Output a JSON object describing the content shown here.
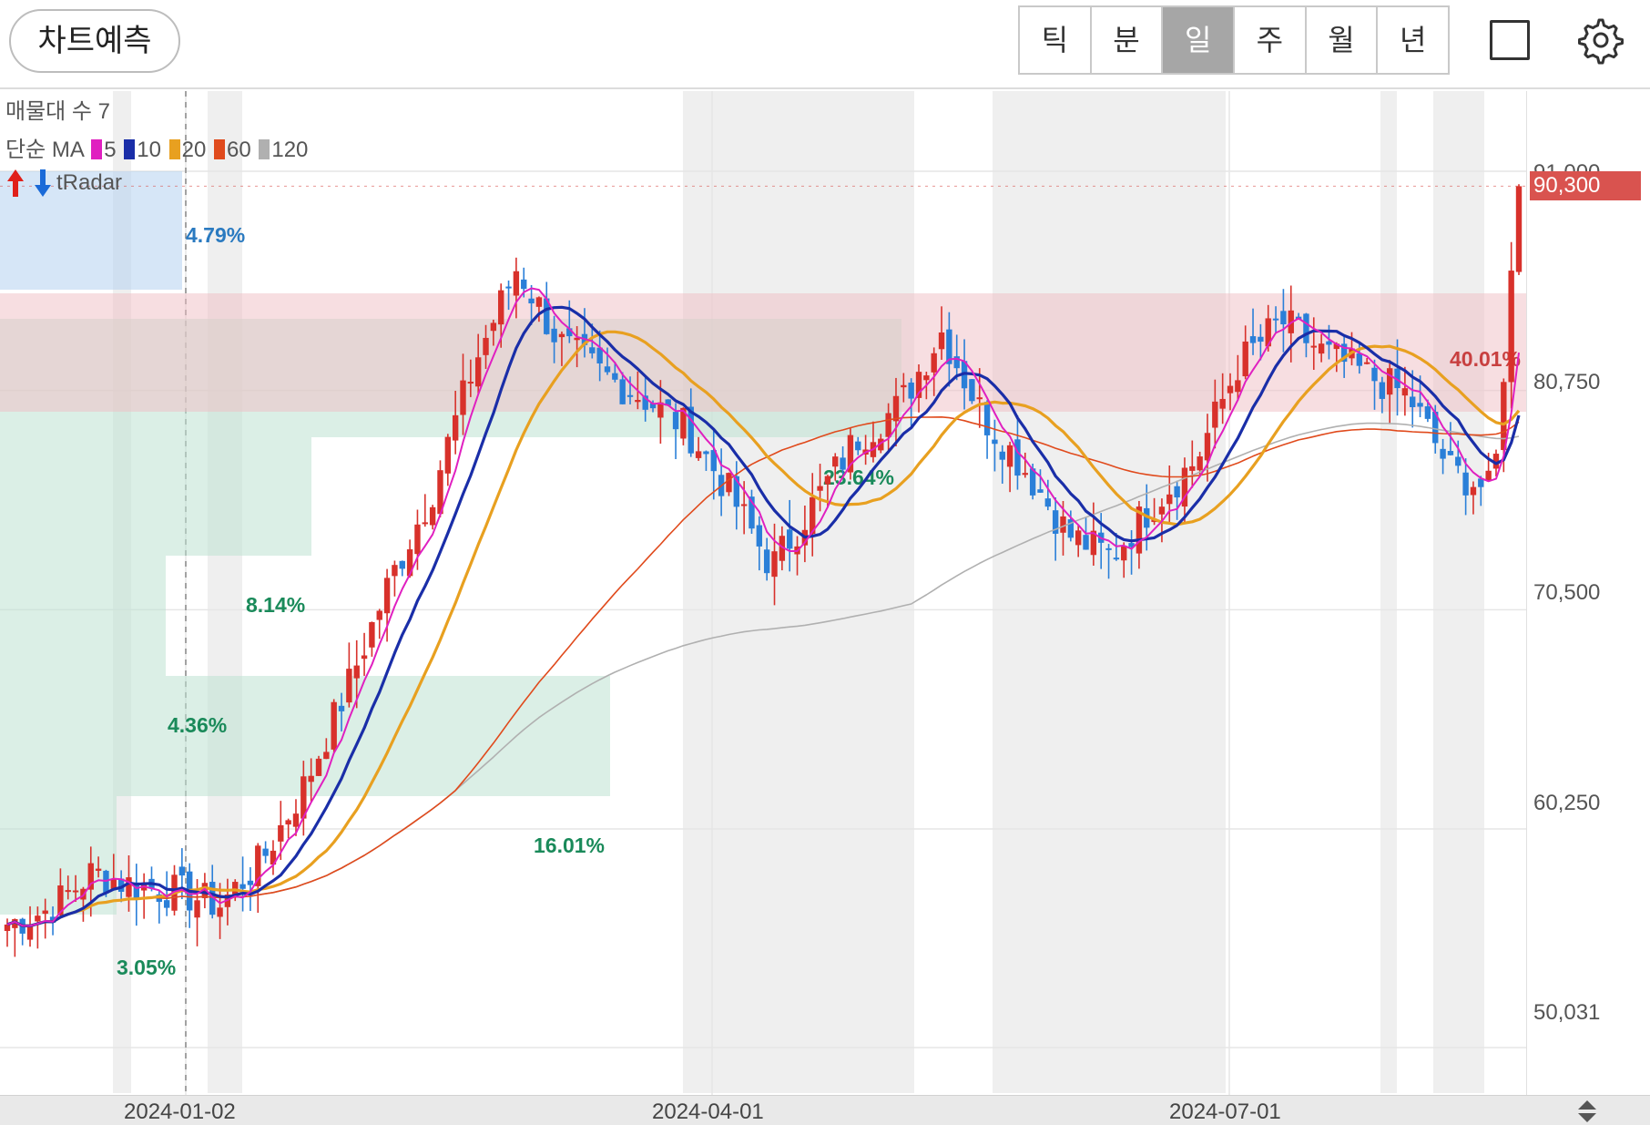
{
  "toolbar": {
    "predict_label": "차트예측",
    "periods": [
      "틱",
      "분",
      "일",
      "주",
      "월",
      "년"
    ],
    "active_period": "일"
  },
  "legend": {
    "volume_profile": "매물대 수 7",
    "ma_label": "단순 MA",
    "ma_periods": [
      "5",
      "10",
      "20",
      "60",
      "120"
    ],
    "ma_colors": [
      "#e020c0",
      "#1a2ea8",
      "#e8a020",
      "#e04a1c",
      "#b0b0b0"
    ],
    "indicator": "tRadar"
  },
  "price": {
    "current": "90,300",
    "y_labels": [
      "91,000",
      "80,750",
      "70,500",
      "60,250",
      "50,031"
    ]
  },
  "x_axis": {
    "labels": [
      "2024-01-02",
      "2024-04-01",
      "2024-07-01"
    ]
  },
  "profile": {
    "labels": [
      "4.79%",
      "8.14%",
      "4.36%",
      "16.01%",
      "3.05%",
      "23.64%",
      "40.01%"
    ]
  },
  "chart_data": {
    "type": "candlestick",
    "ylim": [
      47000,
      95000
    ],
    "current_price": 90300,
    "series": [
      {
        "name": "5",
        "color": "#e020c0"
      },
      {
        "name": "10",
        "color": "#1a2ea8"
      },
      {
        "name": "20",
        "color": "#e8a020"
      },
      {
        "name": "60",
        "color": "#e04a1c"
      },
      {
        "name": "120",
        "color": "#b0b0b0"
      }
    ],
    "close_path_samples": [
      [
        0,
        55800
      ],
      [
        20,
        56500
      ],
      [
        40,
        58200
      ],
      [
        60,
        57600
      ],
      [
        80,
        57300
      ],
      [
        100,
        56700
      ],
      [
        120,
        58800
      ],
      [
        140,
        62300
      ],
      [
        160,
        66800
      ],
      [
        180,
        71800
      ],
      [
        200,
        76000
      ],
      [
        220,
        82000
      ],
      [
        240,
        86500
      ],
      [
        260,
        83000
      ],
      [
        280,
        81500
      ],
      [
        300,
        80400
      ],
      [
        320,
        79000
      ],
      [
        340,
        76000
      ],
      [
        360,
        72500
      ],
      [
        380,
        75500
      ],
      [
        400,
        78500
      ],
      [
        420,
        80000
      ],
      [
        440,
        83500
      ],
      [
        460,
        79500
      ],
      [
        480,
        77000
      ],
      [
        500,
        74000
      ],
      [
        520,
        73000
      ],
      [
        540,
        75500
      ],
      [
        560,
        77500
      ],
      [
        580,
        82000
      ],
      [
        600,
        84000
      ],
      [
        620,
        82500
      ],
      [
        640,
        81500
      ],
      [
        660,
        80500
      ],
      [
        680,
        77000
      ],
      [
        700,
        76000
      ],
      [
        712,
        90300
      ]
    ]
  }
}
